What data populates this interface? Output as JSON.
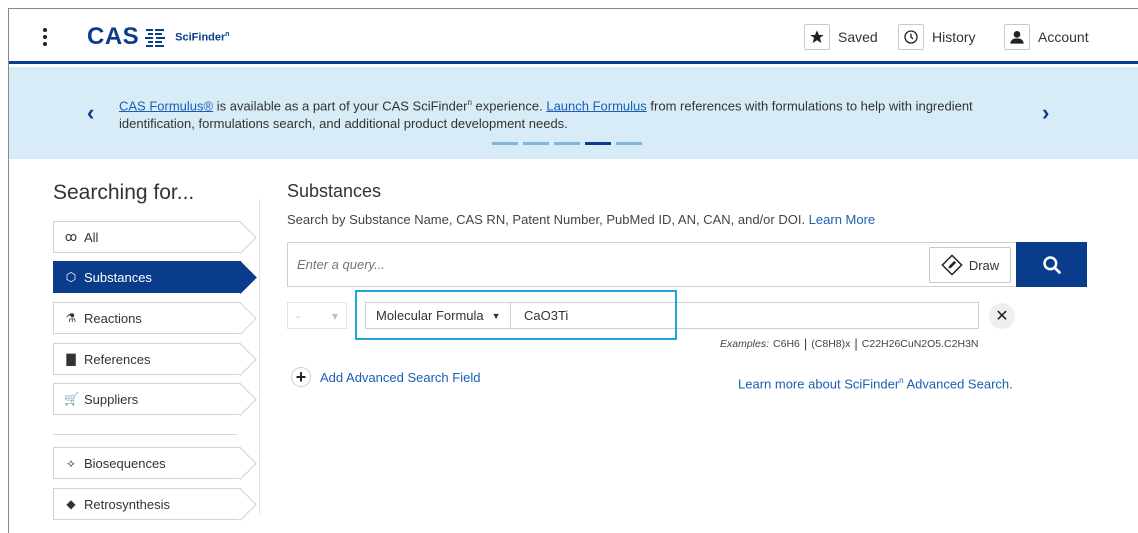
{
  "header": {
    "logo_text": "CAS",
    "product_name": "SciFinder",
    "product_superscript": "n",
    "saved_label": "Saved",
    "history_label": "History",
    "account_label": "Account"
  },
  "banner": {
    "link1": "CAS Formulus®",
    "text1": " is available as a part of your CAS SciFinder",
    "sup": "n",
    "text2": " experience. ",
    "link2": "Launch Formulus",
    "text3": " from references with formulations to help with ingredient identification, formulations search, and additional product development needs.",
    "slide_count": 5,
    "active_slide": 4
  },
  "sidebar": {
    "title": "Searching for...",
    "items": [
      {
        "label": "All",
        "icon": "ꝏ"
      },
      {
        "label": "Substances",
        "icon": "⬡"
      },
      {
        "label": "Reactions",
        "icon": "⚗"
      },
      {
        "label": "References",
        "icon": "▇"
      },
      {
        "label": "Suppliers",
        "icon": "🛒"
      },
      {
        "label": "Biosequences",
        "icon": "⟡"
      },
      {
        "label": "Retrosynthesis",
        "icon": "◆"
      }
    ],
    "active_index": 1
  },
  "main": {
    "title": "Substances",
    "description": "Search by Substance Name, CAS RN, Patent Number, PubMed ID, AN, CAN, and/or DOI. ",
    "learn_more": "Learn More",
    "query_placeholder": "Enter a query...",
    "query_value": "",
    "draw_label": "Draw",
    "operator_value": "-",
    "field_type": "Molecular Formula",
    "field_value": "CaO3Ti",
    "examples_label": "Examples:",
    "examples": [
      "C6H6",
      "(C8H8)x",
      "C22H26CuN2O5.C2H3N"
    ],
    "add_field_label": "Add Advanced Search Field",
    "learn_adv_text": "Learn more about SciFinder",
    "learn_adv_sup": "n",
    "learn_adv_suffix": " Advanced Search."
  },
  "colors": {
    "brand": "#0a3c8c",
    "link": "#1a5fb4",
    "banner_bg": "#d7ecf7",
    "highlight": "#23a4d8"
  }
}
